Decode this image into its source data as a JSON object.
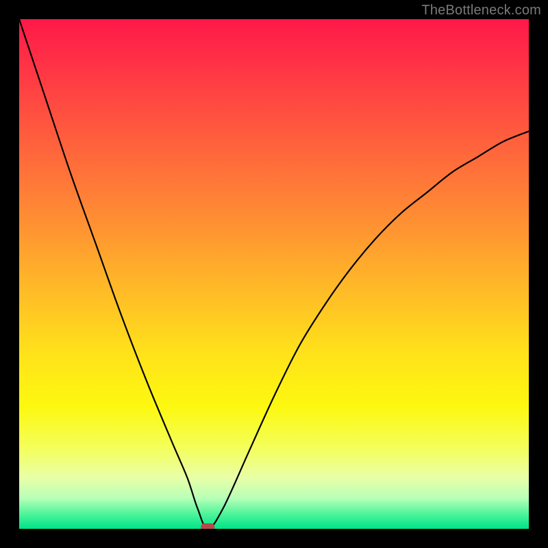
{
  "watermark": "TheBottleneck.com",
  "colors": {
    "frame": "#000000",
    "gradient_top": "#ff1848",
    "gradient_mid_orange": "#ff8a34",
    "gradient_mid_yellow": "#ffe31a",
    "gradient_bottom": "#00e38a",
    "curve": "#000000",
    "marker": "#b64a4a"
  },
  "chart_data": {
    "type": "line",
    "title": "",
    "xlabel": "",
    "ylabel": "",
    "xlim": [
      0,
      100
    ],
    "ylim": [
      0,
      100
    ],
    "grid": false,
    "legend_position": "none",
    "series": [
      {
        "name": "bottleneck-curve",
        "x": [
          0,
          5,
          10,
          15,
          20,
          25,
          30,
          33,
          35,
          37,
          40,
          45,
          50,
          55,
          60,
          65,
          70,
          75,
          80,
          85,
          90,
          95,
          100
        ],
        "values": [
          100,
          85,
          70,
          56,
          42,
          29,
          17,
          10,
          4,
          0,
          4,
          15,
          26,
          36,
          44,
          51,
          57,
          62,
          66,
          70,
          73,
          76,
          78
        ]
      }
    ],
    "annotations": [
      {
        "name": "optimal-point",
        "x": 37,
        "y": 0,
        "shape": "rounded-rect"
      }
    ]
  }
}
